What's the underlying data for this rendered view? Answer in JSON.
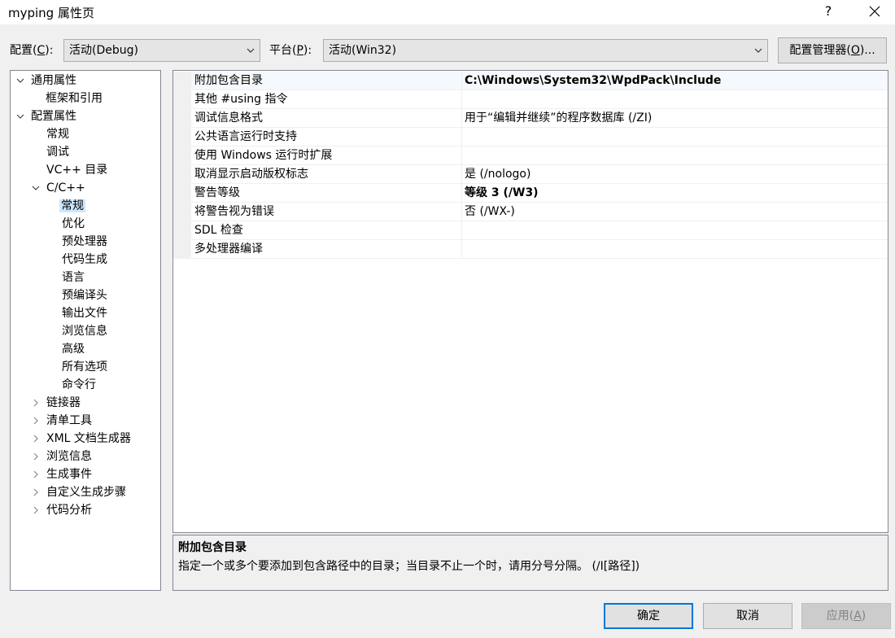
{
  "window": {
    "title": "myping 属性页",
    "help_label": "?"
  },
  "config": {
    "config_label": "配置(",
    "config_key": "C",
    "config_label_end": "):",
    "config_value": "活动(Debug)",
    "platform_label": "平台(",
    "platform_key": "P",
    "platform_label_end": "):",
    "platform_value": "活动(Win32)",
    "manager_label": "配置管理器(",
    "manager_key": "O",
    "manager_label_end": ")..."
  },
  "tree": {
    "items": [
      {
        "label": "通用属性",
        "expanded": true
      },
      {
        "label": "框架和引用"
      },
      {
        "label": "配置属性",
        "expanded": true
      },
      {
        "label": "常规"
      },
      {
        "label": "调试"
      },
      {
        "label": "VC++ 目录"
      },
      {
        "label": "C/C++",
        "expanded": true
      },
      {
        "label": "常规",
        "selected": true
      },
      {
        "label": "优化"
      },
      {
        "label": "预处理器"
      },
      {
        "label": "代码生成"
      },
      {
        "label": "语言"
      },
      {
        "label": "预编译头"
      },
      {
        "label": "输出文件"
      },
      {
        "label": "浏览信息"
      },
      {
        "label": "高级"
      },
      {
        "label": "所有选项"
      },
      {
        "label": "命令行"
      },
      {
        "label": "链接器",
        "expanded": false
      },
      {
        "label": "清单工具",
        "expanded": false
      },
      {
        "label": "XML 文档生成器",
        "expanded": false
      },
      {
        "label": "浏览信息",
        "expanded": false
      },
      {
        "label": "生成事件",
        "expanded": false
      },
      {
        "label": "自定义生成步骤",
        "expanded": false
      },
      {
        "label": "代码分析",
        "expanded": false
      }
    ]
  },
  "properties": [
    {
      "name": "附加包含目录",
      "value": "C:\\Windows\\System32\\WpdPack\\Include",
      "bold": true
    },
    {
      "name": "其他 #using 指令",
      "value": ""
    },
    {
      "name": "调试信息格式",
      "value": "用于“编辑并继续”的程序数据库 (/ZI)"
    },
    {
      "name": "公共语言运行时支持",
      "value": ""
    },
    {
      "name": "使用 Windows 运行时扩展",
      "value": ""
    },
    {
      "name": "取消显示启动版权标志",
      "value": "是 (/nologo)"
    },
    {
      "name": "警告等级",
      "value": "等级 3 (/W3)",
      "bold": true
    },
    {
      "name": "将警告视为错误",
      "value": "否 (/WX-)"
    },
    {
      "name": "SDL 检查",
      "value": ""
    },
    {
      "name": "多处理器编译",
      "value": ""
    }
  ],
  "description": {
    "title": "附加包含目录",
    "text": "指定一个或多个要添加到包含路径中的目录；当目录不止一个时，请用分号分隔。     (/I[路径])"
  },
  "buttons": {
    "ok_label": "确定",
    "cancel_label": "取消",
    "apply_label": "应用(",
    "apply_key": "A",
    "apply_label_end": ")"
  },
  "colors": {
    "accent": "#0078d7",
    "selection": "#cce8ff"
  }
}
